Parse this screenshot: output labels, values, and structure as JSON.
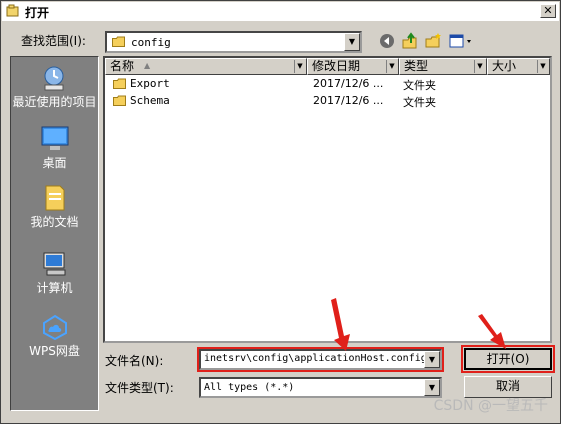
{
  "window": {
    "title": "打开",
    "close_glyph": "✕"
  },
  "lookin": {
    "label": "查找范围(I):",
    "value": "config"
  },
  "toolbar": {
    "back_icon": "back-arrow-icon",
    "up_icon": "up-folder-icon",
    "new_icon": "new-folder-icon",
    "view_icon": "view-menu-icon"
  },
  "places": [
    {
      "label": "最近使用的项目",
      "icon": "recent-items-icon"
    },
    {
      "label": "桌面",
      "icon": "desktop-icon"
    },
    {
      "label": "我的文档",
      "icon": "my-documents-icon"
    },
    {
      "label": "计算机",
      "icon": "computer-icon"
    },
    {
      "label": "WPS网盘",
      "icon": "wps-cloud-icon"
    }
  ],
  "columns": {
    "name": "名称",
    "date": "修改日期",
    "type": "类型",
    "size": "大小"
  },
  "files": [
    {
      "name": "Export",
      "date": "2017/12/6 ...",
      "type": "文件夹"
    },
    {
      "name": "Schema",
      "date": "2017/12/6 ...",
      "type": "文件夹"
    }
  ],
  "filename": {
    "label": "文件名(N):",
    "value": "inetsrv\\config\\applicationHost.config"
  },
  "filetype": {
    "label": "文件类型(T):",
    "value": "All types (*.*)"
  },
  "buttons": {
    "open": "打开(O)",
    "cancel": "取消"
  },
  "watermark": "CSDN @一望五千",
  "colors": {
    "highlight": "#e0201a",
    "dialog_bg": "#d4d0c8",
    "places_bg": "#808080"
  }
}
